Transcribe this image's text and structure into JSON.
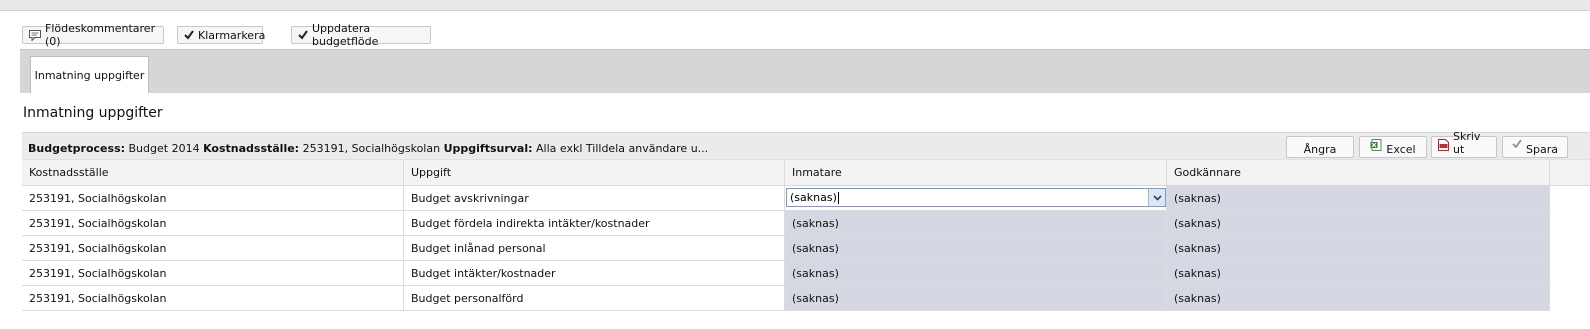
{
  "toolbar": {
    "comments_label": "Flödeskommentarer (0)",
    "mark_ready_label": "Klarmarkera",
    "update_flow_label": "Uppdatera budgetflöde"
  },
  "tabs": [
    {
      "label": "Inmatning uppgifter"
    }
  ],
  "section": {
    "title": "Inmatning uppgifter"
  },
  "info_bar": {
    "process_label": "Budgetprocess:",
    "process_value": "Budget 2014",
    "cost_center_label": "Kostnadsställe:",
    "cost_center_value": "253191, Socialhögskolan",
    "selection_label": "Uppgiftsurval:",
    "selection_value": "Alla exkl Tilldela användare u..."
  },
  "actions": {
    "undo_label": "Ångra",
    "excel_label": "Excel",
    "print_label": "Skriv ut",
    "save_label": "Spara"
  },
  "table": {
    "columns": [
      "Kostnadsställe",
      "Uppgift",
      "Inmatare",
      "Godkännare"
    ],
    "rows": [
      {
        "cost_center": "253191, Socialhögskolan",
        "task": "Budget avskrivningar",
        "entrant": "(saknas)",
        "approver": "(saknas)"
      },
      {
        "cost_center": "253191, Socialhögskolan",
        "task": "Budget fördela indirekta intäkter/kostnader",
        "entrant": "(saknas)",
        "approver": "(saknas)"
      },
      {
        "cost_center": "253191, Socialhögskolan",
        "task": "Budget inlånad personal",
        "entrant": "(saknas)",
        "approver": "(saknas)"
      },
      {
        "cost_center": "253191, Socialhögskolan",
        "task": "Budget intäkter/kostnader",
        "entrant": "(saknas)",
        "approver": "(saknas)"
      },
      {
        "cost_center": "253191, Socialhögskolan",
        "task": "Budget personalförd",
        "entrant": "(saknas)",
        "approver": "(saknas)"
      }
    ]
  },
  "icons": {
    "comments": "comment-icon",
    "check": "checkmark-icon",
    "excel": "excel-icon",
    "pdf": "pdf-icon",
    "dropdown": "chevron-down-icon"
  },
  "colors": {
    "shaded_cell": "#d5d8e2",
    "select_border": "#7a9cc6"
  }
}
